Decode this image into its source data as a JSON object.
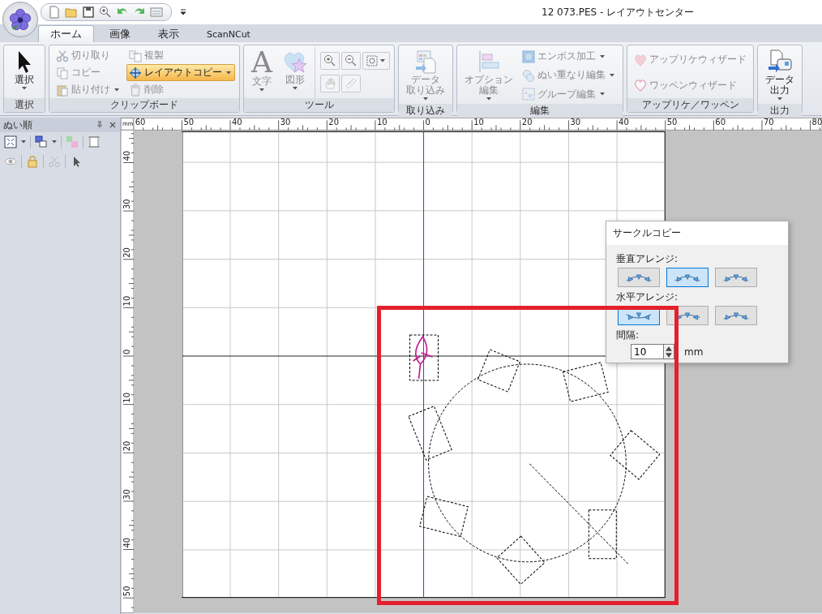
{
  "window": {
    "title": "12 073.PES - レイアウトセンター"
  },
  "ribbon": {
    "tabs": [
      {
        "label": "ホーム",
        "selected": true
      },
      {
        "label": "画像",
        "selected": false
      },
      {
        "label": "表示",
        "selected": false
      },
      {
        "label": "ScanNCut",
        "selected": false
      }
    ],
    "groups": [
      {
        "label": "選択",
        "items": [
          {
            "kind": "large",
            "label": "選択",
            "disabled": false,
            "selected": false,
            "dropdown": true
          }
        ]
      },
      {
        "label": "クリップボード",
        "items": [
          {
            "kind": "small",
            "label": "切り取り",
            "disabled": true,
            "selected": false,
            "dropdown": false
          },
          {
            "kind": "small",
            "label": "コピー",
            "disabled": true,
            "selected": false,
            "dropdown": false
          },
          {
            "kind": "small",
            "label": "貼り付け",
            "disabled": true,
            "selected": false,
            "dropdown": true
          },
          {
            "kind": "small",
            "label": "複製",
            "disabled": true,
            "selected": false,
            "dropdown": false
          },
          {
            "kind": "small",
            "label": "レイアウトコピー",
            "disabled": false,
            "selected": true,
            "dropdown": true
          },
          {
            "kind": "small",
            "label": "削除",
            "disabled": true,
            "selected": false,
            "dropdown": false
          }
        ]
      },
      {
        "label": "ツール",
        "items": [
          {
            "kind": "large",
            "label": "文字",
            "icon_text": "A",
            "disabled": true,
            "selected": false,
            "dropdown": true
          },
          {
            "kind": "large",
            "label": "図形",
            "disabled": true,
            "selected": false,
            "dropdown": true
          },
          {
            "kind": "icon",
            "disabled": false,
            "selected": false,
            "dropdown": false
          },
          {
            "kind": "icon",
            "disabled": false,
            "selected": false,
            "dropdown": false
          },
          {
            "kind": "icon",
            "disabled": false,
            "selected": false,
            "dropdown": true
          },
          {
            "kind": "icon",
            "disabled": true,
            "selected": false,
            "dropdown": false
          },
          {
            "kind": "icon",
            "disabled": true,
            "selected": false,
            "dropdown": false
          }
        ]
      },
      {
        "label": "取り込み",
        "items": [
          {
            "kind": "large",
            "lines": [
              "データ",
              "取り込み"
            ],
            "disabled": true,
            "selected": false,
            "dropdown": true
          }
        ]
      },
      {
        "label": "編集",
        "items": [
          {
            "kind": "large",
            "lines": [
              "オプション",
              "編集"
            ],
            "disabled": true,
            "selected": false,
            "dropdown": true
          },
          {
            "kind": "small",
            "label": "エンボス加工",
            "disabled": true,
            "selected": false,
            "dropdown": true
          },
          {
            "kind": "small",
            "label": "ぬい重なり編集",
            "disabled": true,
            "selected": false,
            "dropdown": true
          },
          {
            "kind": "small",
            "label": "グループ編集",
            "disabled": true,
            "selected": false,
            "dropdown": true
          }
        ]
      },
      {
        "label": "アップリケ／ワッペン",
        "items": [
          {
            "kind": "small",
            "label": "アップリケウィザード",
            "disabled": true,
            "selected": false,
            "dropdown": false
          },
          {
            "kind": "small",
            "label": "ワッペンウィザード",
            "disabled": true,
            "selected": false,
            "dropdown": false
          }
        ]
      },
      {
        "label": "出力",
        "items": [
          {
            "kind": "large",
            "lines": [
              "データ",
              "出力"
            ],
            "disabled": false,
            "selected": false,
            "dropdown": true
          }
        ]
      }
    ]
  },
  "panel": {
    "title": "ぬい順"
  },
  "rulers": {
    "unit": "mm",
    "horizontal": [
      "60",
      "50",
      "40",
      "30",
      "20",
      "10",
      "0",
      "10",
      "20",
      "30",
      "40",
      "50",
      "60",
      "70",
      "80"
    ],
    "vertical": [
      "40",
      "30",
      "20",
      "10",
      "0",
      "10",
      "20",
      "30",
      "40",
      "50"
    ]
  },
  "dialog": {
    "title": "サークルコピー",
    "sections": [
      {
        "label": "垂直アレンジ:",
        "options": [
          {
            "selected": false
          },
          {
            "selected": true
          },
          {
            "selected": false
          }
        ]
      },
      {
        "label": "水平アレンジ:",
        "options": [
          {
            "selected": true
          },
          {
            "selected": false
          },
          {
            "selected": false
          }
        ]
      }
    ],
    "spacing": {
      "label": "間隔:",
      "value": "10",
      "unit": "mm"
    }
  }
}
